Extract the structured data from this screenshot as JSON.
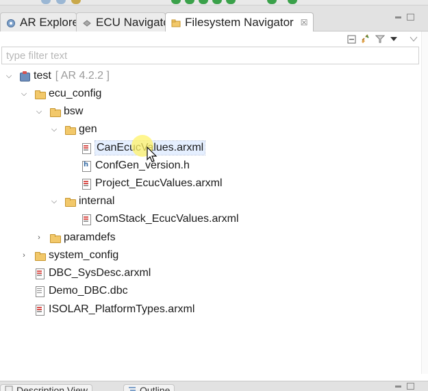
{
  "tabs": [
    {
      "label": "AR Explorer",
      "icon": "ar-explorer-icon",
      "active": false
    },
    {
      "label": "ECU Navigator",
      "icon": "ecu-navigator-icon",
      "active": false
    },
    {
      "label": "Filesystem Navigator",
      "icon": "filesystem-navigator-icon",
      "active": true,
      "close": "☒"
    }
  ],
  "filter": {
    "placeholder": "type filter text"
  },
  "tree": {
    "root": {
      "label": "test",
      "suffix": "[ AR 4.2.2 ]"
    },
    "ecu_config": "ecu_config",
    "bsw": "bsw",
    "gen": "gen",
    "gen_files": [
      "CanEcucValues.arxml",
      "ConfGen_version.h",
      "Project_EcucValues.arxml"
    ],
    "internal": "internal",
    "internal_files": [
      "ComStack_EcucValues.arxml"
    ],
    "paramdefs": "paramdefs",
    "system_config": "system_config",
    "root_files": [
      "DBC_SysDesc.arxml",
      "Demo_DBC.dbc",
      "ISOLAR_PlatformTypes.arxml"
    ]
  },
  "bottom_tabs": [
    {
      "label": "Description View",
      "icon": "description-view-icon"
    },
    {
      "label": "Outline",
      "icon": "outline-icon"
    }
  ],
  "colors": {
    "folder": "#f2c86a",
    "selection": "#e5efff",
    "cursor_highlight": "#fff36a"
  }
}
